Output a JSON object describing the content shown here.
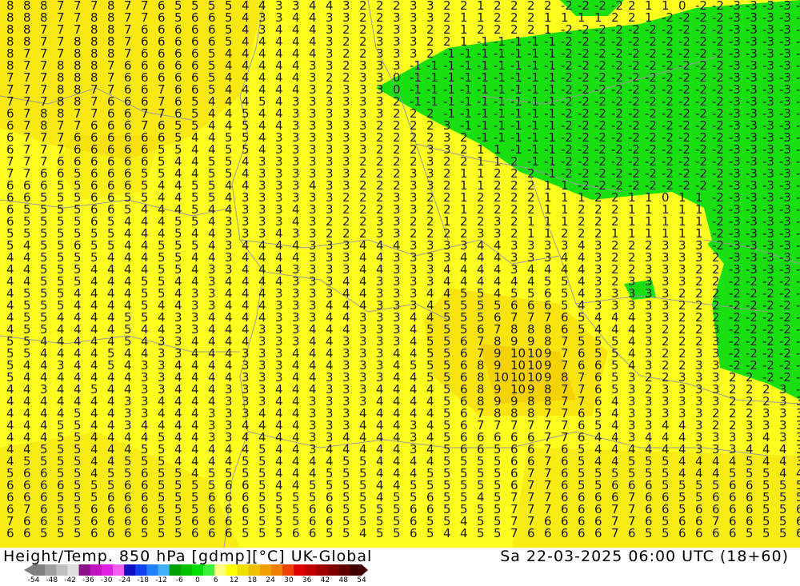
{
  "map": {
    "product": "Height/Temp. 850 hPa [gdmp][°C]",
    "model": "UK-Global",
    "valid_time": "Sa 22-03-2025 06:00 UTC (18+60)"
  },
  "colors": {
    "cold_negative": "#16e00f",
    "temp_0_6": "#fefe1e",
    "temp_6_12": "#f2d000",
    "text": "#1a1a1a",
    "borders": "#9a9a9a"
  },
  "legend": {
    "ticks": [
      "-54",
      "-48",
      "-42",
      "-36",
      "-30",
      "-24",
      "-18",
      "-12",
      "-6",
      "0",
      "6",
      "12",
      "18",
      "24",
      "30",
      "36",
      "42",
      "48",
      "54"
    ],
    "colors": [
      "#7f7f7f",
      "#9f9f9f",
      "#bfbfbf",
      "#dfdfdf",
      "#8c0f8c",
      "#c010c0",
      "#e020e0",
      "#f060f0",
      "#1010c0",
      "#1040f0",
      "#2080ff",
      "#40b0ff",
      "#00a000",
      "#00c000",
      "#00e000",
      "#40f040",
      "#ffff80",
      "#ffff00",
      "#f0e000",
      "#f0c000",
      "#f0a000",
      "#f08000",
      "#f04000",
      "#e00000",
      "#c00000",
      "#a00000",
      "#800000",
      "#600000",
      "#400000"
    ]
  }
}
